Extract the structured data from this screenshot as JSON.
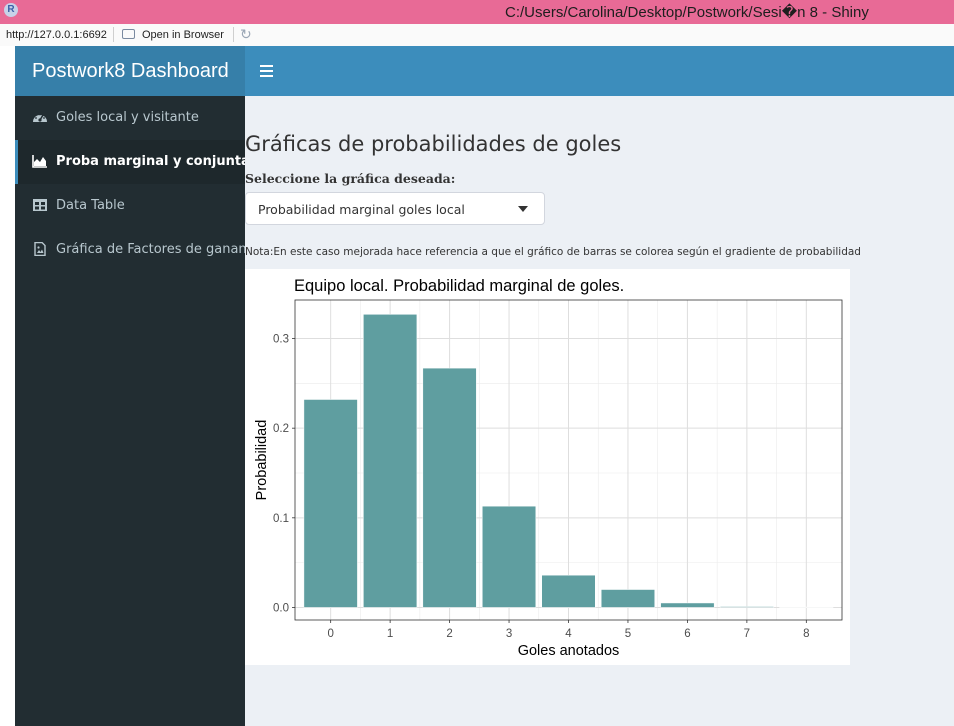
{
  "window": {
    "title": "C:/Users/Carolina/Desktop/Postwork/Sesi�n 8 - Shiny",
    "app_icon": "r-logo-icon",
    "app_icon_letter": "R"
  },
  "browser_bar": {
    "url": "http://127.0.0.1:6692",
    "open_in_browser": "Open in Browser",
    "open_icon": "window-open-icon",
    "refresh_icon": "refresh-icon"
  },
  "header": {
    "logo": "Postwork8 Dashboard",
    "toggle_icon": "hamburger-menu-icon"
  },
  "sidebar": {
    "items": [
      {
        "label": "Goles local y visitante",
        "icon": "dashboard-gauge-icon",
        "active": false
      },
      {
        "label": "Proba marginal y conjunta",
        "icon": "area-chart-icon",
        "active": true
      },
      {
        "label": "Data Table",
        "icon": "table-icon",
        "active": false
      },
      {
        "label": "Gráfica de Factores de ganancia",
        "icon": "file-image-icon",
        "active": false
      }
    ]
  },
  "main": {
    "title": "Gráficas de probabilidades de goles",
    "select_label": "Seleccione la gráfica deseada:",
    "select_value": "Probabilidad marginal goles local",
    "note": "Nota:En este caso mejorada hace referencia a que el gráfico de barras se colorea según el gradiente de probabilidad"
  },
  "chart_data": {
    "type": "bar",
    "title": "Equipo local. Probabilidad marginal de goles.",
    "xlabel": "Goles anotados",
    "ylabel": "Probabilidad",
    "categories": [
      "0",
      "1",
      "2",
      "3",
      "4",
      "5",
      "6",
      "7",
      "8"
    ],
    "values": [
      0.232,
      0.327,
      0.267,
      0.113,
      0.036,
      0.02,
      0.005,
      0.001,
      0.0005
    ],
    "yticks": [
      "0.0",
      "0.1",
      "0.2",
      "0.3"
    ],
    "ylim": [
      -0.014,
      0.343
    ],
    "grid": true,
    "bar_color": "#5f9ea0"
  }
}
